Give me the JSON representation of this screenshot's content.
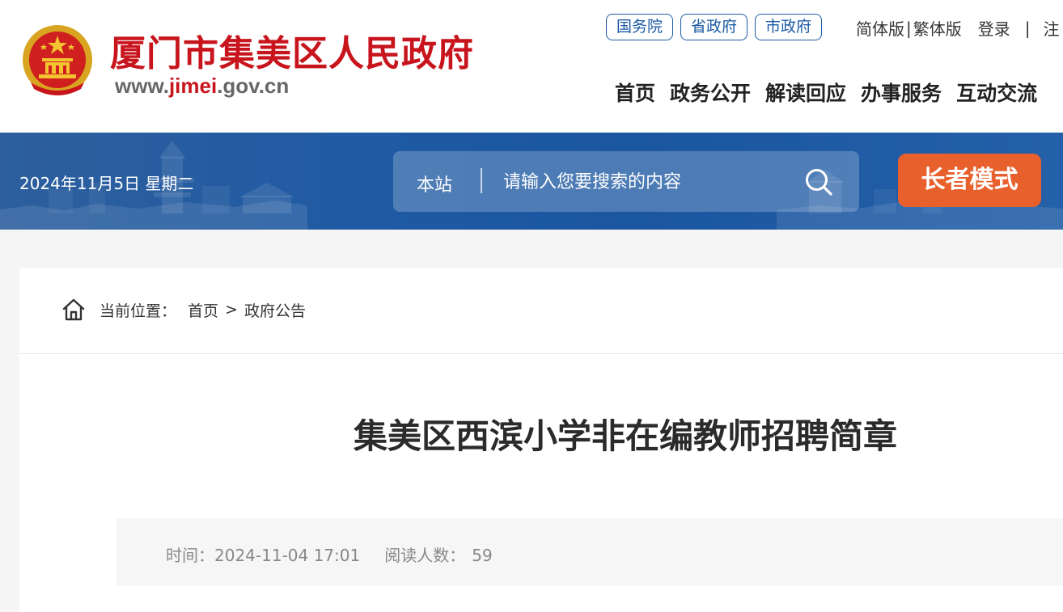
{
  "header": {
    "site_title": "厦门市集美区人民政府",
    "site_url_prefix": "www.",
    "site_url_highlight": "jimei",
    "site_url_suffix": ".gov.cn",
    "gov_links": [
      "国务院",
      "省政府",
      "市政府"
    ],
    "simplified_label": "简体版",
    "separator": "|",
    "traditional_label": "繁体版",
    "login_label": "登录",
    "pipe": "|",
    "more_label": "注",
    "nav": [
      "首页",
      "政务公开",
      "解读回应",
      "办事服务",
      "互动交流"
    ]
  },
  "banner": {
    "date": "2024年11月5日 星期二",
    "search_scope": "本站",
    "search_placeholder": "请输入您要搜索的内容",
    "elder_mode_label": "长者模式"
  },
  "breadcrumb": {
    "prefix": "当前位置：",
    "home": "首页",
    "separator": ">",
    "current": "政府公告"
  },
  "article": {
    "title": "集美区西滨小学非在编教师招聘简章",
    "time_label": "时间：",
    "time_value": "2024-11-04 17:01",
    "reads_label": "阅读人数：",
    "reads_value": "59"
  },
  "colors": {
    "brand_red": "#c8151d",
    "link_blue": "#1a5aa6",
    "banner_blue": "#1f5aa3",
    "elder_orange": "#e8602c"
  },
  "icons": [
    "national-emblem-icon",
    "search-icon",
    "home-icon"
  ]
}
